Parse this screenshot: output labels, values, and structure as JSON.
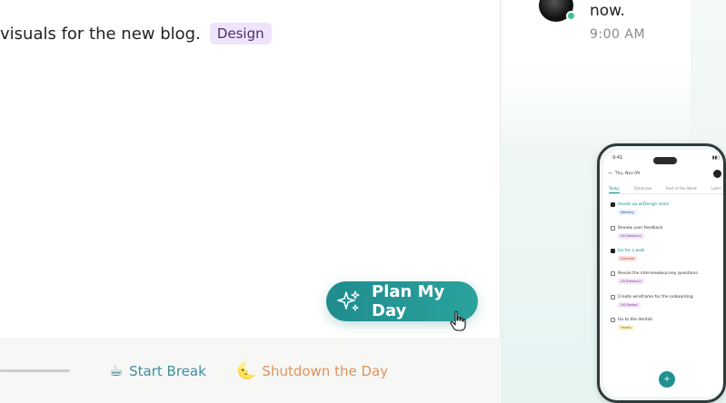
{
  "task": {
    "text": "visuals for the new blog.",
    "tag": "Design"
  },
  "plan_button": {
    "label": "Plan My Day"
  },
  "bottom_bar": {
    "break": {
      "emoji": "☕",
      "label": "Start Break"
    },
    "shutdown": {
      "emoji": "🌜",
      "label": "Shutdown the Day"
    }
  },
  "chat": {
    "message": "now.",
    "time": "9:00 AM"
  },
  "phone": {
    "status_time": "9:41",
    "date_header": "Thu, Nov 09",
    "tabs": [
      "Today",
      "Tomorrow",
      "Rest of the Week",
      "Later"
    ],
    "tasks": [
      {
        "title": "Heads up w/Design team",
        "tag": "Meeting",
        "checked": true
      },
      {
        "title": "Review user feedback",
        "tag": "UX Research",
        "checked": false
      },
      {
        "title": "Go for a walk",
        "tag": "Exercise",
        "checked": true
      },
      {
        "title": "Revise the interview&survey questions.",
        "tag": "UX Research",
        "checked": false
      },
      {
        "title": "Create wireframe for the onboarding",
        "tag": "UX Design",
        "checked": false
      },
      {
        "title": "Go to the dentist",
        "tag": "Health",
        "checked": false
      }
    ],
    "fab_label": "+"
  },
  "colors": {
    "accent": "#1f8c8e",
    "break": "#3e8fa0",
    "shutdown": "#e0915a",
    "design_tag_bg": "#efe4fb"
  }
}
